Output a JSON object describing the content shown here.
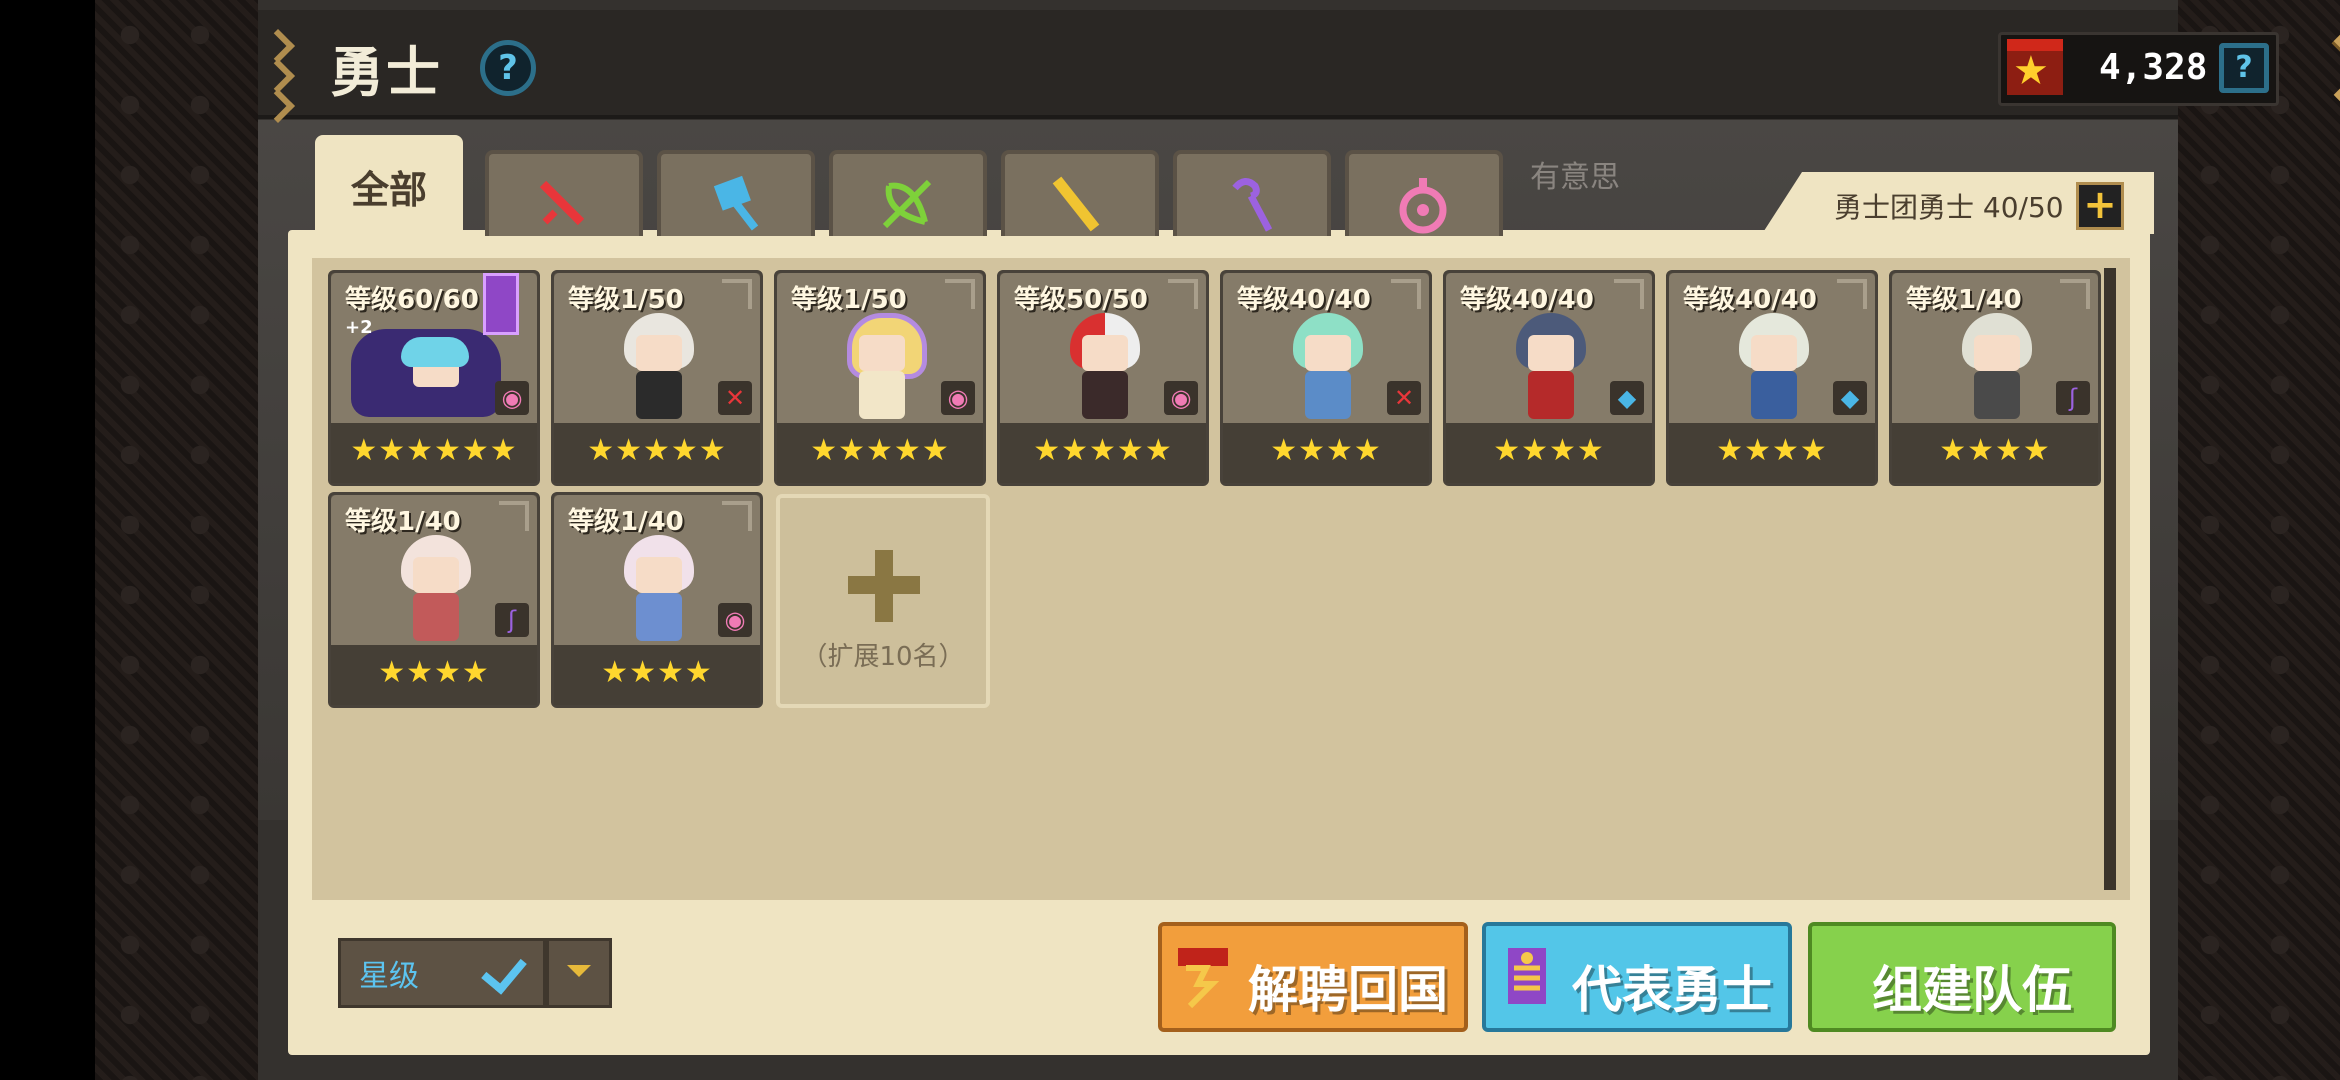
{
  "header": {
    "title": "勇士",
    "currency_value": "4,328"
  },
  "tabs": {
    "all_label": "全部",
    "weapon_icons": [
      "sword-icon",
      "hammer-icon",
      "bow-icon",
      "gun-icon",
      "staff-icon",
      "orb-icon"
    ],
    "hint": "有意思"
  },
  "roster": {
    "label": "勇士团勇士 40/50"
  },
  "heroes": [
    {
      "level": "等级60/60",
      "stars": "★★★★★★",
      "class": "orb",
      "extra": "+2"
    },
    {
      "level": "等级1/50",
      "stars": "★★★★★",
      "class": "sword"
    },
    {
      "level": "等级1/50",
      "stars": "★★★★★",
      "class": "orb"
    },
    {
      "level": "等级50/50",
      "stars": "★★★★★",
      "class": "orb"
    },
    {
      "level": "等级40/40",
      "stars": "★★★★",
      "class": "sword"
    },
    {
      "level": "等级40/40",
      "stars": "★★★★",
      "class": "hammer"
    },
    {
      "level": "等级40/40",
      "stars": "★★★★",
      "class": "hammer"
    },
    {
      "level": "等级1/40",
      "stars": "★★★★",
      "class": "staff"
    },
    {
      "level": "等级1/40",
      "stars": "★★★★",
      "class": "staff"
    },
    {
      "level": "等级1/40",
      "stars": "★★★★",
      "class": "orb"
    }
  ],
  "expand": {
    "label": "（扩展10名）"
  },
  "sort": {
    "label": "星级"
  },
  "buttons": {
    "dismiss": "解聘回国",
    "representative": "代表勇士",
    "form_team": "组建队伍"
  }
}
